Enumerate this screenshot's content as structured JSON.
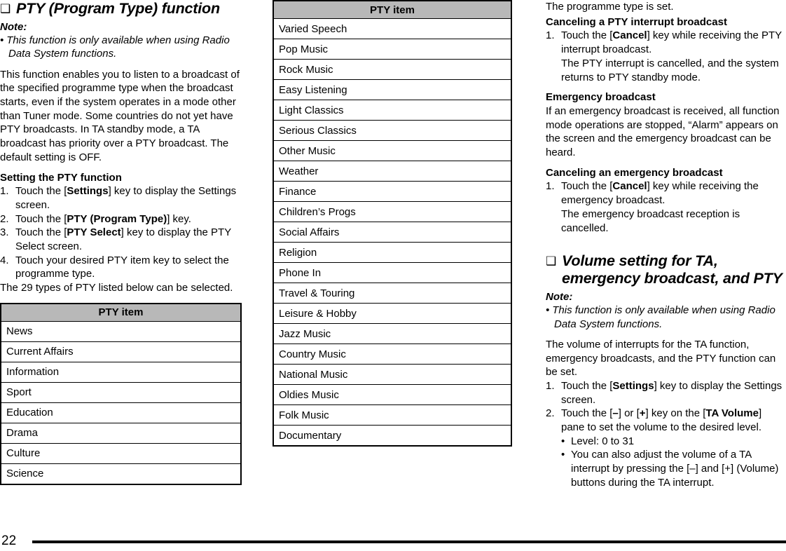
{
  "document": {
    "page_number": "22",
    "icon_glyph": "❑",
    "bullet_glyph": "•",
    "colors": {
      "table_header_bg": "#b8b8b8",
      "text": "#000000",
      "page_bg": "#ffffff",
      "rule": "#000000"
    }
  },
  "column_1": {
    "section_title": "PTY (Program Type) function",
    "note_label": "Note:",
    "note_items": [
      "This function is only available when using Radio Data System functions."
    ],
    "intro_paragraph": "This function enables you to listen to a broadcast of the specified programme type when the broadcast starts, even if the system operates in a mode other than Tuner mode. Some countries do not yet have PTY broadcasts.\nIn TA standby mode, a TA broadcast has priority over a PTY broadcast.\nThe default setting is OFF.",
    "intro_lines": [
      "This function enables you to listen to a",
      "broadcast of the specified programme type",
      "when the broadcast starts, even if the system",
      "operates in a mode other than Tuner mode.",
      "Some countries do not yet have PTY",
      "broadcasts.",
      "In TA standby mode, a TA broadcast has",
      "priority over a PTY broadcast.",
      "The default setting is OFF."
    ],
    "sub_heading": "Setting the PTY function",
    "steps": [
      {
        "number": "1.",
        "parts": [
          {
            "text": "Touch the [",
            "bold": false
          },
          {
            "text": "Settings",
            "bold": true
          },
          {
            "text": "] key to display the Settings screen.",
            "bold": false
          }
        ]
      },
      {
        "number": "2.",
        "parts": [
          {
            "text": "Touch the [",
            "bold": false
          },
          {
            "text": "PTY (Program Type)",
            "bold": true
          },
          {
            "text": "] key.",
            "bold": false
          }
        ]
      },
      {
        "number": "3.",
        "parts": [
          {
            "text": "Touch the [",
            "bold": false
          },
          {
            "text": "PTY Select",
            "bold": true
          },
          {
            "text": "] key to display the PTY Select screen.",
            "bold": false
          }
        ]
      },
      {
        "number": "4.",
        "parts": [
          {
            "text": "Touch your desired PTY item key to select the programme type.",
            "bold": false
          }
        ]
      }
    ],
    "after_steps_paragraph": "The 29 types of PTY listed below can be selected.",
    "table": {
      "header": "PTY item",
      "rows": [
        "News",
        "Current Affairs",
        "Information",
        "Sport",
        "Education",
        "Drama",
        "Culture",
        "Science"
      ]
    }
  },
  "column_2": {
    "table": {
      "header": "PTY item",
      "rows": [
        "Varied Speech",
        "Pop Music",
        "Rock Music",
        "Easy Listening",
        "Light Classics",
        "Serious Classics",
        "Other Music",
        "Weather",
        "Finance",
        "Children’s Progs",
        "Social Affairs",
        "Religion",
        "Phone In",
        "Travel & Touring",
        "Leisure & Hobby",
        "Jazz Music",
        "Country Music",
        "National Music",
        "Oldies Music",
        "Folk Music",
        "Documentary"
      ]
    }
  },
  "column_3": {
    "lead_line": "The programme type is set.",
    "heading_cancel_pty": "Canceling a PTY interrupt broadcast",
    "steps_cancel_pty": [
      {
        "number": "1.",
        "parts": [
          {
            "text": "Touch the [",
            "bold": false
          },
          {
            "text": "Cancel",
            "bold": true
          },
          {
            "text": "] key while receiving the PTY interrupt broadcast.",
            "bold": false
          }
        ],
        "follow_up": "The PTY interrupt is cancelled, and the system returns to PTY standby mode."
      }
    ],
    "heading_emergency": "Emergency broadcast",
    "emergency_paragraph": "If an emergency broadcast is received, all function mode operations are stopped, “Alarm” appears on the screen and the emergency broadcast can be heard.",
    "heading_cancel_emergency": "Canceling an emergency broadcast",
    "steps_cancel_emergency": [
      {
        "number": "1.",
        "parts": [
          {
            "text": "Touch the [",
            "bold": false
          },
          {
            "text": "Cancel",
            "bold": true
          },
          {
            "text": "] key while receiving the emergency broadcast.",
            "bold": false
          }
        ],
        "follow_up": "The emergency broadcast reception is cancelled."
      }
    ],
    "section_title": "Volume setting for TA, emergency broadcast, and PTY",
    "note_label": "Note:",
    "note_items": [
      "This function is only available when using Radio Data System functions."
    ],
    "volume_paragraph": "The volume of interrupts for the TA function, emergency broadcasts, and the PTY function can be set.",
    "steps_volume": [
      {
        "number": "1.",
        "parts": [
          {
            "text": "Touch the [",
            "bold": false
          },
          {
            "text": "Settings",
            "bold": true
          },
          {
            "text": "] key to display the Settings screen.",
            "bold": false
          }
        ]
      },
      {
        "number": "2.",
        "parts": [
          {
            "text": "Touch the [",
            "bold": false
          },
          {
            "text": "–",
            "bold": true
          },
          {
            "text": "] or [",
            "bold": false
          },
          {
            "text": "+",
            "bold": true
          },
          {
            "text": "] key on the [",
            "bold": false
          },
          {
            "text": "TA Volume",
            "bold": true
          },
          {
            "text": "] pane to set the volume to the desired level.",
            "bold": false
          }
        ]
      }
    ],
    "volume_bullets": [
      "Level: 0 to 31",
      "You can also adjust the volume of a TA interrupt by pressing the [–] and [+] (Volume) buttons during the TA interrupt."
    ]
  }
}
